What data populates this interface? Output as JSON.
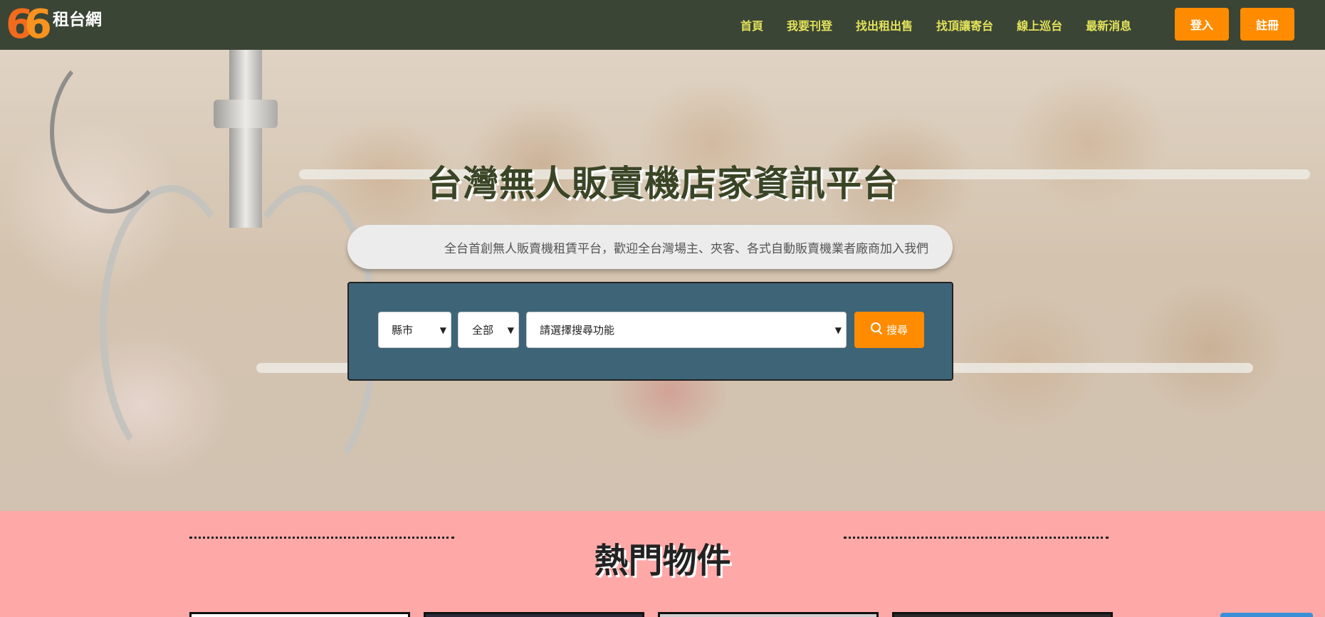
{
  "brand": {
    "name": "租台網",
    "logo_mark": "66"
  },
  "nav": {
    "links": [
      "首頁",
      "我要刊登",
      "找出租出售",
      "找頂讓寄台",
      "線上巡台",
      "最新消息"
    ],
    "login": "登入",
    "register": "註冊"
  },
  "hero": {
    "title": "台灣無人販賣機店家資訊平台",
    "subtitle": "全台首創無人販賣機租賃平台，歡迎全台灣場主、夾客、各式自動販賣機業者廠商加入我們"
  },
  "search": {
    "city_select": "縣市",
    "category_select": "全部",
    "function_select": "請選擇搜尋功能",
    "button": "搜尋"
  },
  "hot": {
    "title": "熱門物件"
  },
  "colors": {
    "navbar": "#3a4536",
    "nav_link": "#e3e35a",
    "accent": "#ff8c00",
    "search_panel": "#3e6478",
    "section_bg": "#ffa8a8"
  },
  "icons": {
    "search": "search-icon",
    "caret": "chevron-down-icon"
  }
}
